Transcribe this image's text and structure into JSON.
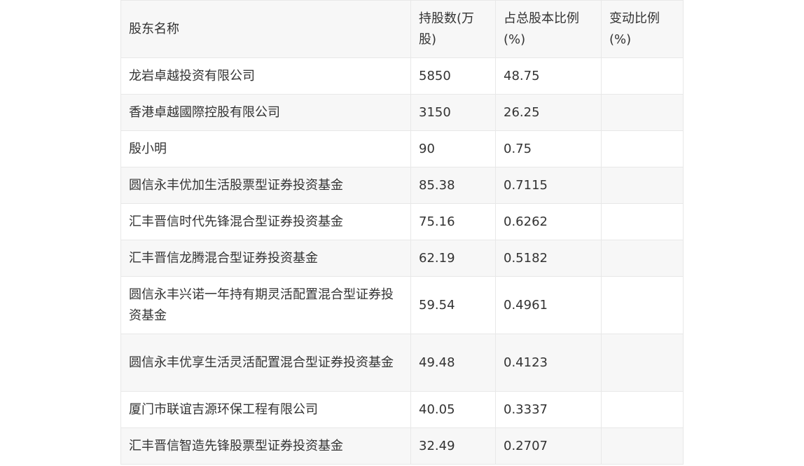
{
  "table": {
    "headers": [
      "股东名称",
      "持股数(万股)",
      "占总股本比例(%)",
      "变动比例(%)"
    ],
    "rows": [
      [
        "龙岩卓越投资有限公司",
        "5850",
        "48.75",
        ""
      ],
      [
        "香港卓越國際控股有限公司",
        "3150",
        "26.25",
        ""
      ],
      [
        "殷小明",
        "90",
        "0.75",
        ""
      ],
      [
        "圆信永丰优加生活股票型证券投资基金",
        "85.38",
        "0.7115",
        ""
      ],
      [
        "汇丰晋信时代先锋混合型证券投资基金",
        "75.16",
        "0.6262",
        ""
      ],
      [
        "汇丰晋信龙腾混合型证券投资基金",
        "62.19",
        "0.5182",
        ""
      ],
      [
        "圆信永丰兴诺一年持有期灵活配置混合型证券投资基金",
        "59.54",
        "0.4961",
        ""
      ],
      [
        "圆信永丰优享生活灵活配置混合型证券投资基金",
        "49.48",
        "0.4123",
        ""
      ],
      [
        "厦门市联谊吉源环保工程有限公司",
        "40.05",
        "0.3337",
        ""
      ],
      [
        "汇丰晋信智造先锋股票型证券投资基金",
        "32.49",
        "0.2707",
        ""
      ]
    ]
  }
}
